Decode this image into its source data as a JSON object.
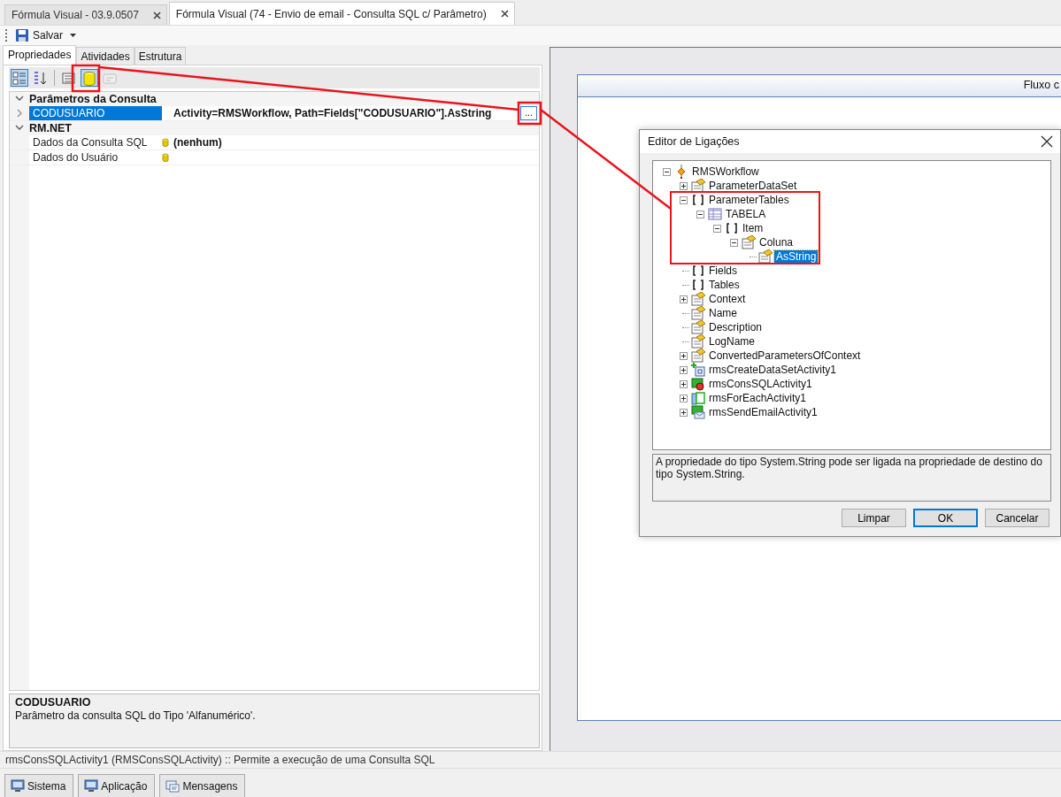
{
  "document_tabs": [
    {
      "label": "Fórmula Visual - 03.9.0507",
      "selected": false
    },
    {
      "label": "Fórmula Visual (74 - Envio de email - Consulta SQL c/ Parâmetro)",
      "selected": true
    }
  ],
  "toolbar": {
    "save_label": "Salvar"
  },
  "left_panel": {
    "tabs": [
      {
        "label": "Propriedades",
        "selected": true
      },
      {
        "label": "Atividades",
        "selected": false
      },
      {
        "label": "Estrutura",
        "selected": false
      }
    ],
    "grid_toolbar": [
      {
        "kind": "categorized",
        "selected": true,
        "disabled": false
      },
      {
        "kind": "alphabetical",
        "selected": false,
        "disabled": false
      },
      {
        "kind": "properties",
        "selected": false,
        "disabled": false
      },
      {
        "kind": "data",
        "selected": true,
        "disabled": false
      },
      {
        "kind": "events",
        "selected": false,
        "disabled": true
      }
    ],
    "property_grid": {
      "categories": [
        {
          "name": "Parâmetros da Consulta",
          "expanded": true,
          "rows": [
            {
              "name": "CODUSUARIO",
              "value": "Activity=RMSWorkflow, Path=Fields[\"CODUSUARIO\"].AsString",
              "selected": true,
              "expandable": true,
              "db_icon": false,
              "button": "..."
            }
          ]
        },
        {
          "name": "RM.NET",
          "expanded": true,
          "rows": [
            {
              "name": "Dados da Consulta SQL",
              "value": "(nenhum)",
              "selected": false,
              "expandable": false,
              "db_icon": true
            },
            {
              "name": "Dados do Usuário",
              "selected": false,
              "expandable": false,
              "db_icon": true
            }
          ]
        }
      ]
    },
    "description": {
      "title": "CODUSUARIO",
      "text": "Parâmetro da consulta SQL do Tipo 'Alfanumérico'."
    }
  },
  "status_bar": "rmsConsSQLActivity1  (RMSConsSQLActivity)  :: Permite a execução de uma Consulta SQL",
  "bottom_tabs": [
    {
      "label": "Sistema"
    },
    {
      "label": "Aplicação"
    },
    {
      "label": "Mensagens"
    }
  ],
  "designer": {
    "header": "Fluxo c"
  },
  "dialog": {
    "title": "Editor de Ligações",
    "tree": [
      {
        "label": "RMSWorkflow",
        "kind": "workflow",
        "expandable": true,
        "expanded": true,
        "selected": false,
        "children": [
          {
            "label": "ParameterDataSet",
            "kind": "property",
            "expandable": true,
            "expanded": false,
            "selected": false
          },
          {
            "label": "ParameterTables",
            "kind": "collection",
            "expandable": true,
            "expanded": true,
            "selected": false,
            "children": [
              {
                "label": "TABELA",
                "kind": "table",
                "expandable": true,
                "expanded": true,
                "selected": false,
                "children": [
                  {
                    "label": "Item",
                    "kind": "collection",
                    "expandable": true,
                    "expanded": true,
                    "selected": false,
                    "children": [
                      {
                        "label": "Coluna",
                        "kind": "property",
                        "expandable": true,
                        "expanded": true,
                        "selected": false,
                        "children": [
                          {
                            "label": "AsString",
                            "kind": "property",
                            "expandable": false,
                            "selected": true
                          }
                        ]
                      }
                    ]
                  }
                ]
              }
            ]
          },
          {
            "label": "Fields",
            "kind": "collection",
            "expandable": false,
            "selected": false
          },
          {
            "label": "Tables",
            "kind": "collection",
            "expandable": false,
            "selected": false
          },
          {
            "label": "Context",
            "kind": "property",
            "expandable": true,
            "expanded": false,
            "selected": false
          },
          {
            "label": "Name",
            "kind": "property",
            "expandable": false,
            "selected": false
          },
          {
            "label": "Description",
            "kind": "property",
            "expandable": false,
            "selected": false
          },
          {
            "label": "LogName",
            "kind": "property",
            "expandable": false,
            "selected": false
          },
          {
            "label": "ConvertedParametersOfContext",
            "kind": "property",
            "expandable": true,
            "expanded": false,
            "selected": false
          },
          {
            "label": "rmsCreateDataSetActivity1",
            "kind": "create",
            "expandable": true,
            "expanded": false,
            "selected": false
          },
          {
            "label": "rmsConsSQLActivity1",
            "kind": "sql",
            "expandable": true,
            "expanded": false,
            "selected": false
          },
          {
            "label": "rmsForEachActivity1",
            "kind": "foreach",
            "expandable": true,
            "expanded": false,
            "selected": false
          },
          {
            "label": "rmsSendEmailActivity1",
            "kind": "email",
            "expandable": true,
            "expanded": false,
            "selected": false
          }
        ]
      }
    ],
    "description": "A propriedade do tipo System.String pode ser ligada na propriedade de destino do tipo System.String.",
    "buttons": [
      {
        "label": "Limpar",
        "default": false
      },
      {
        "label": "OK",
        "default": true
      },
      {
        "label": "Cancelar",
        "default": false
      }
    ]
  }
}
